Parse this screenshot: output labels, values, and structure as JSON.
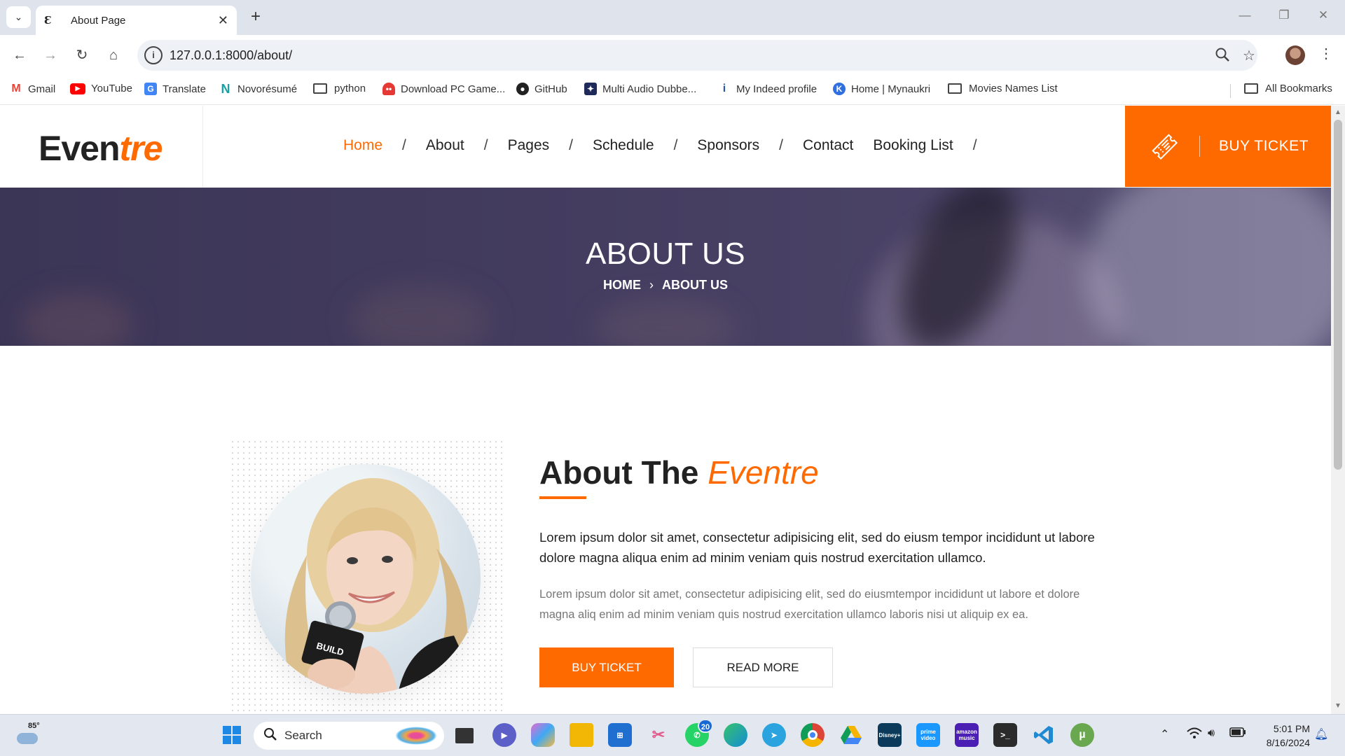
{
  "browser": {
    "tab_title": "About Page",
    "tab_favicon": "Ɛ",
    "url": "127.0.0.1:8000/about/",
    "bookmarks": [
      {
        "label": "Gmail",
        "icon": "gmail-icon",
        "color": "#ea4335"
      },
      {
        "label": "YouTube",
        "icon": "youtube-icon",
        "color": "#ff0000"
      },
      {
        "label": "Translate",
        "icon": "translate-icon",
        "color": "#4285f4"
      },
      {
        "label": "Novorésumé",
        "icon": "novoresume-icon",
        "color": "#17a2a5"
      },
      {
        "label": "python",
        "icon": "folder-icon",
        "color": "#444444"
      },
      {
        "label": "Download PC Game...",
        "icon": "ghost-icon",
        "color": "#e53935"
      },
      {
        "label": "GitHub",
        "icon": "github-icon",
        "color": "#222222"
      },
      {
        "label": "Multi Audio Dubbe...",
        "icon": "dubbing-icon",
        "color": "#1f2a5a"
      },
      {
        "label": "My Indeed profile",
        "icon": "indeed-icon",
        "color": "#2557a7"
      },
      {
        "label": "Home | Mynaukri",
        "icon": "naukri-icon",
        "color": "#2f6fe0"
      },
      {
        "label": "Movies Names List",
        "icon": "folder-icon",
        "color": "#444444"
      }
    ],
    "all_bookmarks": "All Bookmarks"
  },
  "site": {
    "logo_dark": "Even",
    "logo_accent": "tre",
    "accent_color": "#ff6a00",
    "nav": {
      "home": "Home",
      "about": "About",
      "pages": "Pages",
      "schedule": "Schedule",
      "sponsors": "Sponsors",
      "contact": "Contact",
      "booking": "Booking List",
      "sep": "/"
    },
    "buy_ticket": "BUY TICKET"
  },
  "banner": {
    "title": "ABOUT US",
    "crumb_home": "HOME",
    "crumb_sep": "›",
    "crumb_current": "ABOUT US"
  },
  "about": {
    "heading": "About The ",
    "heading_accent": "Eventre",
    "lead": "Lorem ipsum dolor sit amet, consectetur adipisicing elit, sed do eiusm tempor incididunt ut labore dolore magna aliqua enim ad minim veniam quis nostrud exercitation ullamco.",
    "body": "Lorem ipsum dolor sit amet, consectetur adipisicing elit, sed do eiusmtempor incididunt ut labore et dolore magna aliq enim ad minim veniam quis nostrud exercitation ullamco laboris nisi ut aliquip ex ea.",
    "buy_button": "BUY TICKET",
    "read_more": "READ MORE",
    "photo_badge": "BUILD"
  },
  "taskbar": {
    "weather_temp": "85°",
    "search_placeholder": "Search",
    "whatsapp_badge": "20",
    "time": "5:01 PM",
    "date": "8/16/2024",
    "apps": [
      {
        "name": "windows-start-icon",
        "color": "#1e88e5",
        "label": ""
      },
      {
        "name": "task-view-icon",
        "color": "#333333",
        "label": ""
      },
      {
        "name": "teams-meet-icon",
        "color": "#5b5fc7",
        "label": ""
      },
      {
        "name": "copilot-icon",
        "color": "#e46ad1",
        "label": ""
      },
      {
        "name": "file-explorer-icon",
        "color": "#f2b705",
        "label": ""
      },
      {
        "name": "microsoft-store-icon",
        "color": "#1f6fd1",
        "label": ""
      },
      {
        "name": "snipping-tool-icon",
        "color": "#e05a8a",
        "label": ""
      },
      {
        "name": "whatsapp-icon",
        "color": "#25d366",
        "label": ""
      },
      {
        "name": "edge-icon",
        "color": "#138dd6",
        "label": ""
      },
      {
        "name": "telegram-icon",
        "color": "#2aa3df",
        "label": ""
      },
      {
        "name": "chrome-icon",
        "color": "#db4437",
        "label": ""
      },
      {
        "name": "google-drive-icon",
        "color": "#0f9d58",
        "label": ""
      },
      {
        "name": "disney-plus-icon",
        "color": "#0c3a5a",
        "label": "Disney+"
      },
      {
        "name": "prime-video-icon",
        "color": "#1a98ff",
        "label": "prime video"
      },
      {
        "name": "amazon-music-icon",
        "color": "#4b1fb3",
        "label": "amazon music"
      },
      {
        "name": "terminal-icon",
        "color": "#2b2b2b",
        "label": ""
      },
      {
        "name": "vscode-icon",
        "color": "#1f8ad2",
        "label": ""
      },
      {
        "name": "utorrent-icon",
        "color": "#6aa84f",
        "label": ""
      }
    ]
  }
}
